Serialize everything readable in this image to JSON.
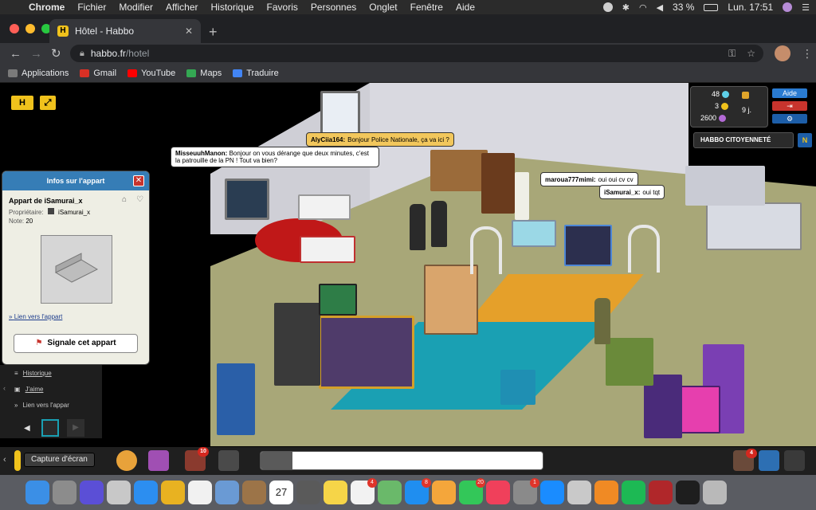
{
  "menubar": {
    "app": "Chrome",
    "items": [
      "Fichier",
      "Modifier",
      "Afficher",
      "Historique",
      "Favoris",
      "Personnes",
      "Onglet",
      "Fenêtre",
      "Aide"
    ],
    "battery": "33 %",
    "clock": "Lun. 17:51"
  },
  "browser": {
    "tab_title": "Hôtel - Habbo",
    "tab_favicon": "H",
    "url_host": "habbo.fr",
    "url_path": "/hotel",
    "bookmarks": [
      {
        "label": "Applications",
        "color": "#7a7a7a"
      },
      {
        "label": "Gmail",
        "color": "#d93025"
      },
      {
        "label": "YouTube",
        "color": "#ff0000"
      },
      {
        "label": "Maps",
        "color": "#34a853"
      },
      {
        "label": "Traduire",
        "color": "#4285f4"
      }
    ]
  },
  "game": {
    "purse": {
      "diamonds": "48",
      "credits": "3",
      "duckets": "2600",
      "club_days": "9 j."
    },
    "buttons": {
      "help": "Aide",
      "exit": "⇥",
      "settings": "⚙"
    },
    "citizenship": "HABBO CITOYENNETÉ",
    "citizenship_icon": "N",
    "chat": [
      {
        "name": "AlyCiia164:",
        "text": "Bonjour Police Nationale, ça va ici ?",
        "style": "yellow"
      },
      {
        "name": "MisseuuhManon:",
        "text": "Bonjour on vous dérange que deux minutes, c'est la patrouille de la PN ! Tout va bien?",
        "style": "white"
      },
      {
        "name": "maroua777mimi:",
        "text": "oui oui cv cv",
        "style": "white"
      },
      {
        "name": "iSamurai_x:",
        "text": "oui tqt",
        "style": "white"
      }
    ],
    "room_info": {
      "header": "Infos sur l'appart",
      "room_name": "Appart de iSamurai_x",
      "owner_label": "Propriétaire:",
      "owner": "iSamurai_x",
      "rating_label": "Note:",
      "rating": "20",
      "link": "Lien vers l'appart",
      "report_button": "Signale cet appart"
    },
    "side_menu": [
      "Historique",
      "J'aime",
      "Lien vers l'appar"
    ],
    "tooltip": "Capture d'écran",
    "badges": {
      "friends": "10",
      "notifications": "4"
    }
  },
  "dock": [
    {
      "name": "finder-icon",
      "color": "#3b8fe6"
    },
    {
      "name": "screenshot-icon",
      "color": "#8c8c8c"
    },
    {
      "name": "siri-icon",
      "color": "#5b4fd6"
    },
    {
      "name": "launchpad-icon",
      "color": "#c8c8c8"
    },
    {
      "name": "safari-icon",
      "color": "#2c8ef0"
    },
    {
      "name": "chrome-icon",
      "color": "#e8b221"
    },
    {
      "name": "document-icon",
      "color": "#f1f1f1"
    },
    {
      "name": "preview-icon",
      "color": "#6a9ad4"
    },
    {
      "name": "notes-brown-icon",
      "color": "#9c7448"
    },
    {
      "name": "calendar-icon",
      "color": "#ffffff",
      "text": "27"
    },
    {
      "name": "calculator-icon",
      "color": "#5a5a5a"
    },
    {
      "name": "notes-icon",
      "color": "#f6d548"
    },
    {
      "name": "reminders-icon",
      "color": "#f2f2f2",
      "badge": "4"
    },
    {
      "name": "maps-icon",
      "color": "#6ab96a"
    },
    {
      "name": "messenger-icon",
      "color": "#1f8ef0",
      "badge": "8"
    },
    {
      "name": "photos-icon",
      "color": "#f4a63b"
    },
    {
      "name": "facetime-icon",
      "color": "#33c759",
      "badge": "20"
    },
    {
      "name": "music-icon",
      "color": "#f0405b"
    },
    {
      "name": "system-preferences-icon",
      "color": "#8a8a8a",
      "badge": "1"
    },
    {
      "name": "app-store-icon",
      "color": "#1a8cff"
    },
    {
      "name": "disk-utility-icon",
      "color": "#c9c9c9"
    },
    {
      "name": "books-icon",
      "color": "#f08a24"
    },
    {
      "name": "spotify-icon",
      "color": "#1db954"
    },
    {
      "name": "dictionary-icon",
      "color": "#b0272a"
    },
    {
      "name": "terminal-icon",
      "color": "#1e1e1e"
    },
    {
      "name": "trash-icon",
      "color": "#b9b9b9"
    }
  ]
}
